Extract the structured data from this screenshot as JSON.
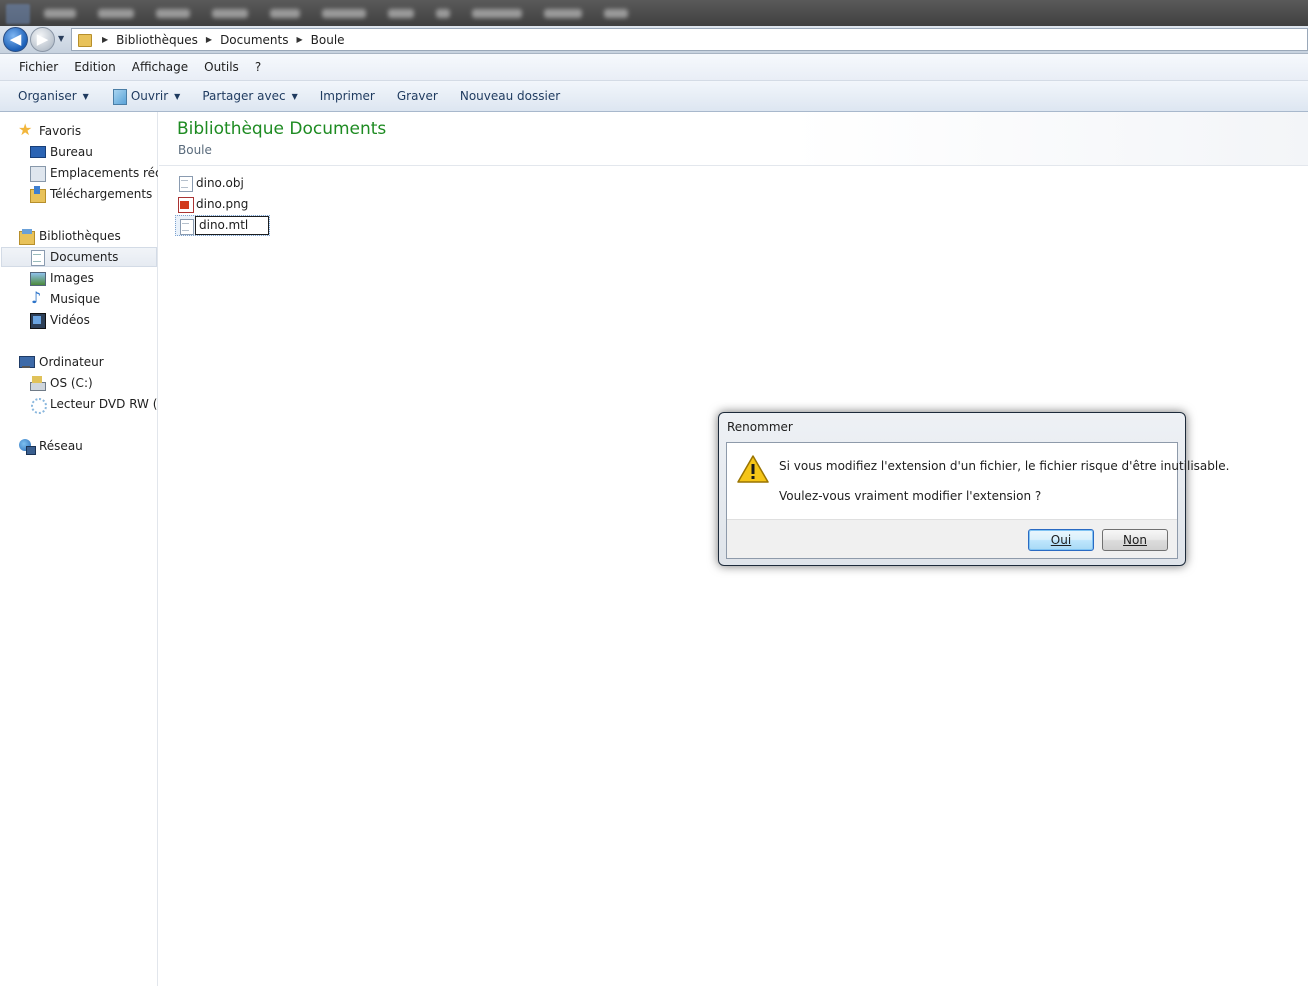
{
  "address": {
    "crumbs": [
      "Bibliothèques",
      "Documents",
      "Boule"
    ]
  },
  "menubar": {
    "items": [
      "Fichier",
      "Edition",
      "Affichage",
      "Outils",
      "?"
    ]
  },
  "toolbar": {
    "organize": "Organiser",
    "open": "Ouvrir",
    "share": "Partager avec",
    "print": "Imprimer",
    "burn": "Graver",
    "new_folder": "Nouveau dossier"
  },
  "sidebar": {
    "favorites": "Favoris",
    "desktop": "Bureau",
    "recent": "Emplacements récents",
    "downloads": "Téléchargements",
    "libraries": "Bibliothèques",
    "documents": "Documents",
    "images": "Images",
    "music": "Musique",
    "videos": "Vidéos",
    "computer": "Ordinateur",
    "drive_c": "OS (C:)",
    "dvd": "Lecteur DVD RW (E:)",
    "network": "Réseau"
  },
  "main": {
    "title": "Bibliothèque Documents",
    "subtitle": "Boule",
    "files": [
      "dino.obj",
      "dino.png"
    ],
    "rename_value": "dino.mtl"
  },
  "dialog": {
    "title": "Renommer",
    "message1": "Si vous modifiez l'extension d'un fichier, le fichier risque d'être inutilisable.",
    "message2": "Voulez-vous vraiment modifier l'extension ?",
    "yes_label": "Oui",
    "no_label": "Non"
  },
  "colors": {
    "title_green": "#1e8b22",
    "accent_blue": "#2a6ac2"
  }
}
